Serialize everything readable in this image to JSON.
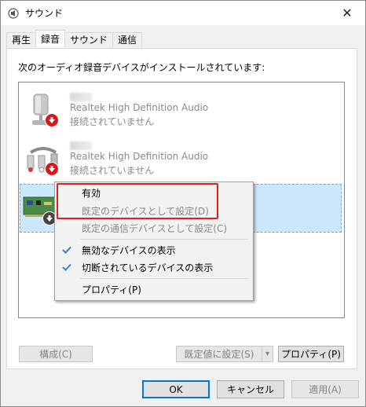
{
  "window": {
    "title": "サウンド",
    "close_glyph": "✕"
  },
  "tabs": [
    {
      "label": "再生",
      "active": false
    },
    {
      "label": "録音",
      "active": true
    },
    {
      "label": "サウンド",
      "active": false
    },
    {
      "label": "通信",
      "active": false
    }
  ],
  "intro_text": "次のオーディオ録音デバイスがインストールされています:",
  "devices": [
    {
      "name": "Realtek High Definition Audio",
      "status": "接続されていません",
      "icon": "microphone-icon",
      "badge": "disabled-down-arrow-icon"
    },
    {
      "name": "Realtek High Definition Audio",
      "status": "接続されていません",
      "icon": "line-in-cable-icon",
      "badge": "disabled-down-arrow-icon"
    },
    {
      "name": "",
      "status": "",
      "icon": "sound-card-icon",
      "badge": "disabled-down-arrow-icon",
      "selected": true
    }
  ],
  "context_menu": {
    "items": [
      {
        "label": "有効",
        "checked": false,
        "disabled": false
      },
      {
        "label": "既定のデバイスとして設定(D)",
        "checked": false,
        "disabled": true
      },
      {
        "label": "既定の通信デバイスとして設定(C)",
        "checked": false,
        "disabled": true
      },
      {
        "label": "無効なデバイスの表示",
        "checked": true,
        "disabled": false
      },
      {
        "label": "切断されているデバイスの表示",
        "checked": true,
        "disabled": false
      },
      {
        "label": "プロパティ(P)",
        "checked": false,
        "disabled": false
      }
    ],
    "highlight_color": "#e02020"
  },
  "panel_buttons": {
    "configure": "構成(C)",
    "set_default": "既定値に設定(S)",
    "properties": "プロパティ(P)"
  },
  "dialog_buttons": {
    "ok": "OK",
    "cancel": "キャンセル",
    "apply": "適用(A)"
  },
  "colors": {
    "selection_bg": "#cce8ff",
    "badge_red": "#d81818",
    "check_blue": "#3a7dd6",
    "default_button_border": "#0078d7"
  }
}
